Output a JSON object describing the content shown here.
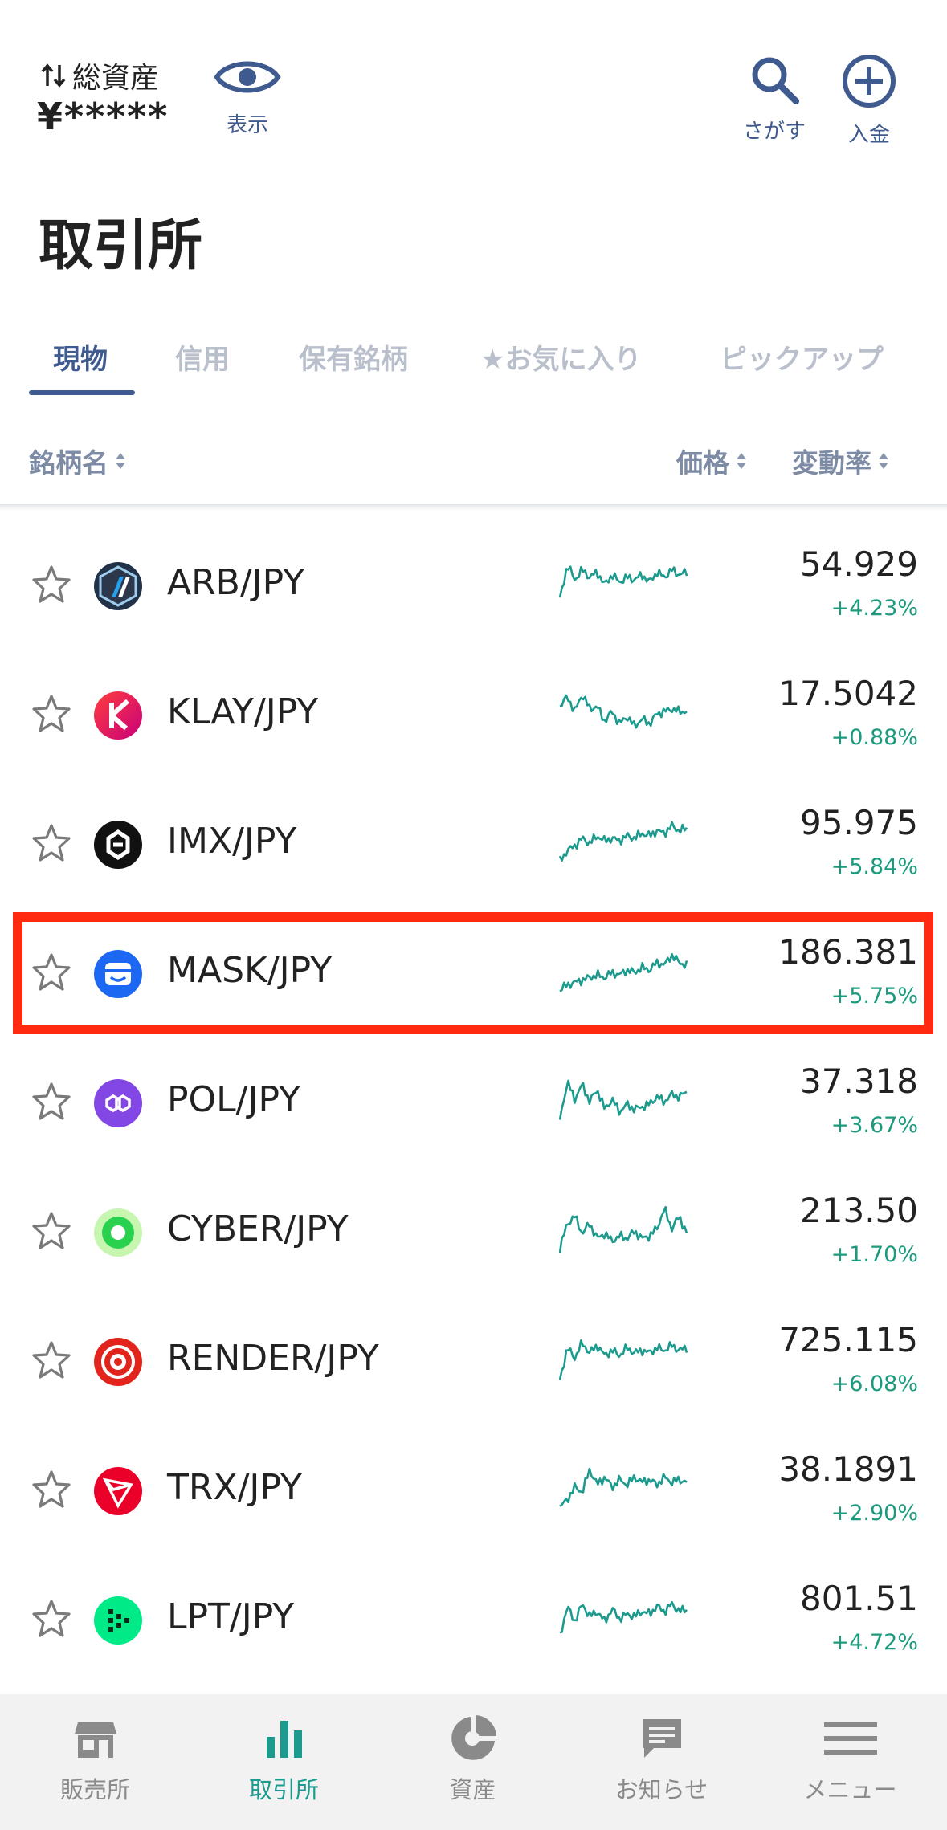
{
  "header": {
    "asset_label": "総資産",
    "asset_value": "¥*****",
    "show_label": "表示",
    "search_label": "さがす",
    "deposit_label": "入金"
  },
  "title": "取引所",
  "tabs": [
    {
      "label": "現物",
      "active": true
    },
    {
      "label": "信用",
      "active": false
    },
    {
      "label": "保有銘柄",
      "active": false
    },
    {
      "label": "★お気に入り",
      "active": false
    },
    {
      "label": "ピックアップ",
      "active": false
    }
  ],
  "columns": {
    "name": "銘柄名",
    "price": "価格",
    "change": "変動率"
  },
  "colors": {
    "accent": "#3f5a8e",
    "positive": "#1c9a7e",
    "highlight": "#ff2a10",
    "nav_active": "#1c9a8e"
  },
  "rows": [
    {
      "pair": "ARB/JPY",
      "price": "54.929",
      "change": "+4.23%",
      "icon": "arbitrum-icon",
      "spark": [
        0.15,
        0.85,
        0.55,
        0.75,
        0.6,
        0.7,
        0.45,
        0.65,
        0.5,
        0.6,
        0.55,
        0.65,
        0.5,
        0.7,
        0.6,
        0.75,
        0.65,
        0.7
      ]
    },
    {
      "pair": "KLAY/JPY",
      "price": "17.5042",
      "change": "+0.88%",
      "icon": "klaytn-icon",
      "spark": [
        0.6,
        0.8,
        0.5,
        0.85,
        0.55,
        0.6,
        0.3,
        0.5,
        0.25,
        0.4,
        0.2,
        0.35,
        0.25,
        0.45,
        0.5,
        0.55,
        0.5,
        0.5
      ]
    },
    {
      "pair": "IMX/JPY",
      "price": "95.975",
      "change": "+5.84%",
      "icon": "immutable-icon",
      "spark": [
        0.1,
        0.3,
        0.4,
        0.55,
        0.45,
        0.6,
        0.5,
        0.55,
        0.5,
        0.6,
        0.55,
        0.65,
        0.6,
        0.7,
        0.65,
        0.8,
        0.7,
        0.75
      ]
    },
    {
      "pair": "MASK/JPY",
      "price": "186.381",
      "change": "+5.75%",
      "icon": "mask-network-icon",
      "spark": [
        0.1,
        0.2,
        0.25,
        0.3,
        0.35,
        0.4,
        0.35,
        0.45,
        0.4,
        0.5,
        0.45,
        0.55,
        0.5,
        0.65,
        0.6,
        0.8,
        0.65,
        0.6
      ]
    },
    {
      "pair": "POL/JPY",
      "price": "37.318",
      "change": "+3.67%",
      "icon": "polygon-icon",
      "spark": [
        0.1,
        0.85,
        0.5,
        0.8,
        0.45,
        0.7,
        0.3,
        0.5,
        0.25,
        0.4,
        0.3,
        0.35,
        0.4,
        0.55,
        0.45,
        0.6,
        0.55,
        0.65
      ]
    },
    {
      "pair": "CYBER/JPY",
      "price": "213.50",
      "change": "+1.70%",
      "icon": "cyber-icon",
      "spark": [
        0.1,
        0.6,
        0.75,
        0.4,
        0.6,
        0.3,
        0.4,
        0.25,
        0.35,
        0.3,
        0.45,
        0.3,
        0.35,
        0.5,
        0.9,
        0.5,
        0.75,
        0.4
      ]
    },
    {
      "pair": "RENDER/JPY",
      "price": "725.115",
      "change": "+6.08%",
      "icon": "render-icon",
      "spark": [
        0.05,
        0.7,
        0.5,
        0.8,
        0.6,
        0.75,
        0.55,
        0.65,
        0.55,
        0.7,
        0.6,
        0.65,
        0.6,
        0.7,
        0.65,
        0.75,
        0.65,
        0.7
      ]
    },
    {
      "pair": "TRX/JPY",
      "price": "38.1891",
      "change": "+2.90%",
      "icon": "tron-icon",
      "spark": [
        0.1,
        0.25,
        0.5,
        0.4,
        0.85,
        0.55,
        0.7,
        0.5,
        0.65,
        0.55,
        0.7,
        0.6,
        0.65,
        0.55,
        0.7,
        0.6,
        0.65,
        0.6
      ]
    },
    {
      "pair": "LPT/JPY",
      "price": "801.51",
      "change": "+4.72%",
      "icon": "livepeer-icon",
      "spark": [
        0.1,
        0.7,
        0.4,
        0.75,
        0.5,
        0.6,
        0.4,
        0.65,
        0.45,
        0.55,
        0.5,
        0.6,
        0.55,
        0.7,
        0.6,
        0.75,
        0.6,
        0.65
      ]
    }
  ],
  "nav": [
    {
      "label": "販売所",
      "icon": "shop-icon",
      "active": false
    },
    {
      "label": "取引所",
      "icon": "bar-chart-icon",
      "active": true
    },
    {
      "label": "資産",
      "icon": "pie-chart-icon",
      "active": false
    },
    {
      "label": "お知らせ",
      "icon": "message-icon",
      "active": false
    },
    {
      "label": "メニュー",
      "icon": "menu-icon",
      "active": false
    }
  ]
}
